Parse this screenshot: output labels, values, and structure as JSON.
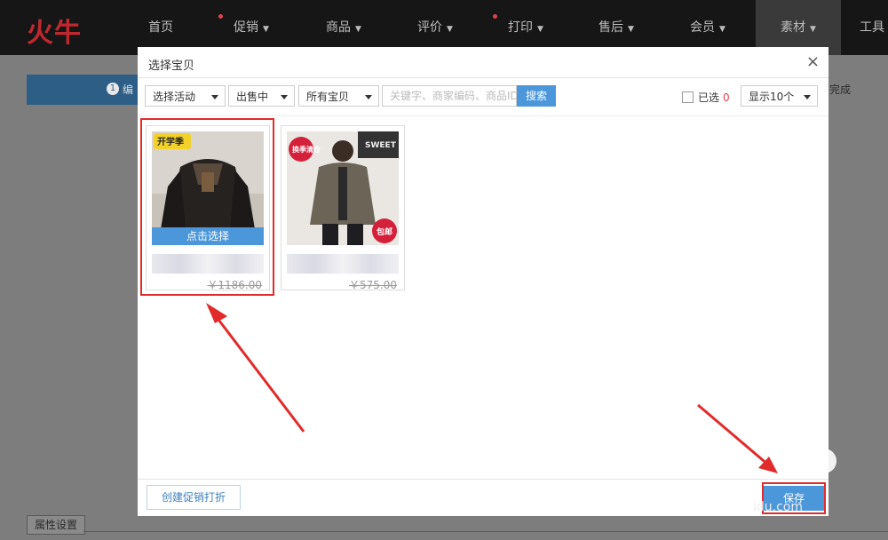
{
  "brand": {
    "logo_text": "火牛"
  },
  "nav": [
    {
      "label": "首页",
      "has_caret": false,
      "has_dot": false
    },
    {
      "label": "促销",
      "has_caret": true,
      "has_dot": true
    },
    {
      "label": "商品",
      "has_caret": true,
      "has_dot": false
    },
    {
      "label": "评价",
      "has_caret": true,
      "has_dot": false
    },
    {
      "label": "打印",
      "has_caret": true,
      "has_dot": true
    },
    {
      "label": "售后",
      "has_caret": true,
      "has_dot": false
    },
    {
      "label": "会员",
      "has_caret": true,
      "has_dot": false
    },
    {
      "label": "素材",
      "has_caret": true,
      "has_dot": false,
      "active": true
    },
    {
      "label": "工具",
      "has_caret": false,
      "has_dot": false
    }
  ],
  "background": {
    "step_number": "1",
    "step_label": "编",
    "step_done_label": "完成",
    "attr_tab_label": "属性设置"
  },
  "modal": {
    "title": "选择宝贝",
    "close_symbol": "×",
    "filters": {
      "activity": "选择活动",
      "status": "出售中",
      "scope": "所有宝贝"
    },
    "search": {
      "placeholder": "关键字、商家编码、商品ID",
      "button_label": "搜索"
    },
    "selected": {
      "label": "已选",
      "count": "0"
    },
    "page_size": "显示10个",
    "products": [
      {
        "price": "￥1186.00",
        "badge": "开学季",
        "select_label": "点击选择"
      },
      {
        "price": "￥575.00",
        "badge": "换季清仓",
        "badge2": "包邮",
        "banner": "SWEET"
      }
    ],
    "footer": {
      "promo_button": "创建促销打折",
      "save_button": "保存"
    }
  },
  "watermark": {
    "text": "idu.com"
  },
  "colors": {
    "accent_blue": "#4b97da",
    "annotation_red": "#e12b2b",
    "logo_red": "#c0282e"
  }
}
